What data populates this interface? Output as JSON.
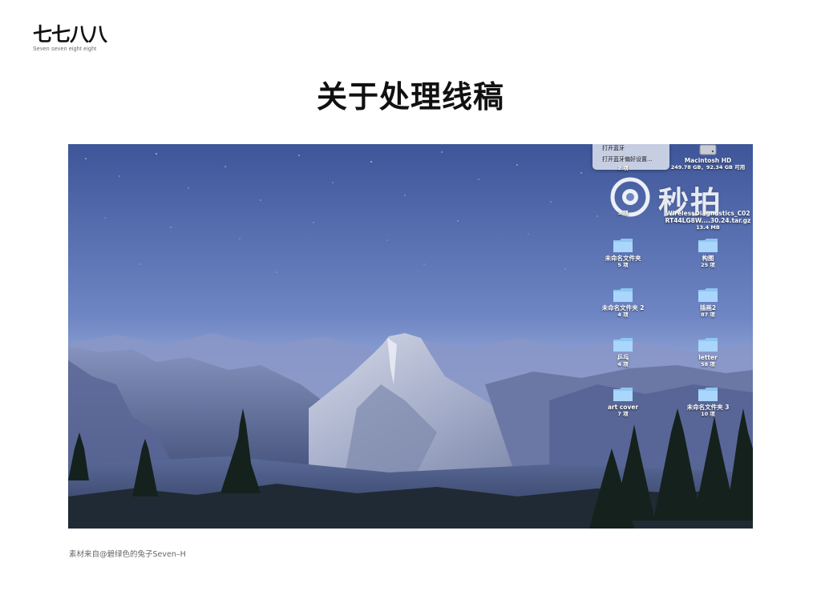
{
  "header": {
    "logo_mark": "七七八八",
    "logo_sub": "Seven seven eight eight",
    "title": "关于处理线稿"
  },
  "screenshot": {
    "menu": {
      "items": [
        "打开蓝牙",
        "打开蓝牙偏好设置..."
      ]
    },
    "watermark": "秒拍",
    "desktop_icons": [
      {
        "label": "Macintosh HD",
        "sub": "249.78 GB，92.34 GB 可用",
        "icon": "hard-drive-icon"
      },
      {
        "label": "",
        "sub": "2 项",
        "icon": "folder-icon"
      },
      {
        "label": "",
        "sub": "3 项",
        "icon": "folder-icon"
      },
      {
        "label": "WirelessDiagnostics_C02RT44LG8W....30.24.tar.gz",
        "label_line1": "WirelessDiagnostics_C02",
        "label_line2": "RT44LG8W....30.24.tar.gz",
        "sub": "13.4 MB",
        "icon": "archive-icon"
      },
      {
        "label": "未命名文件夹",
        "sub": "5 项",
        "icon": "folder-icon"
      },
      {
        "label": "构图",
        "sub": "25 项",
        "icon": "folder-icon"
      },
      {
        "label": "未命名文件夹 2",
        "sub": "4 项",
        "icon": "folder-icon"
      },
      {
        "label": "插画2",
        "sub": "87 项",
        "icon": "folder-icon"
      },
      {
        "label": "乒乓",
        "sub": "4 项",
        "icon": "folder-icon"
      },
      {
        "label": "letter",
        "sub": "58 项",
        "icon": "folder-icon"
      },
      {
        "label": "art cover",
        "sub": "7 项",
        "icon": "folder-icon"
      },
      {
        "label": "未命名文件夹 3",
        "sub": "10 项",
        "icon": "folder-icon"
      }
    ]
  },
  "caption": "素材来自@碧绿色的兔子Seven–H"
}
